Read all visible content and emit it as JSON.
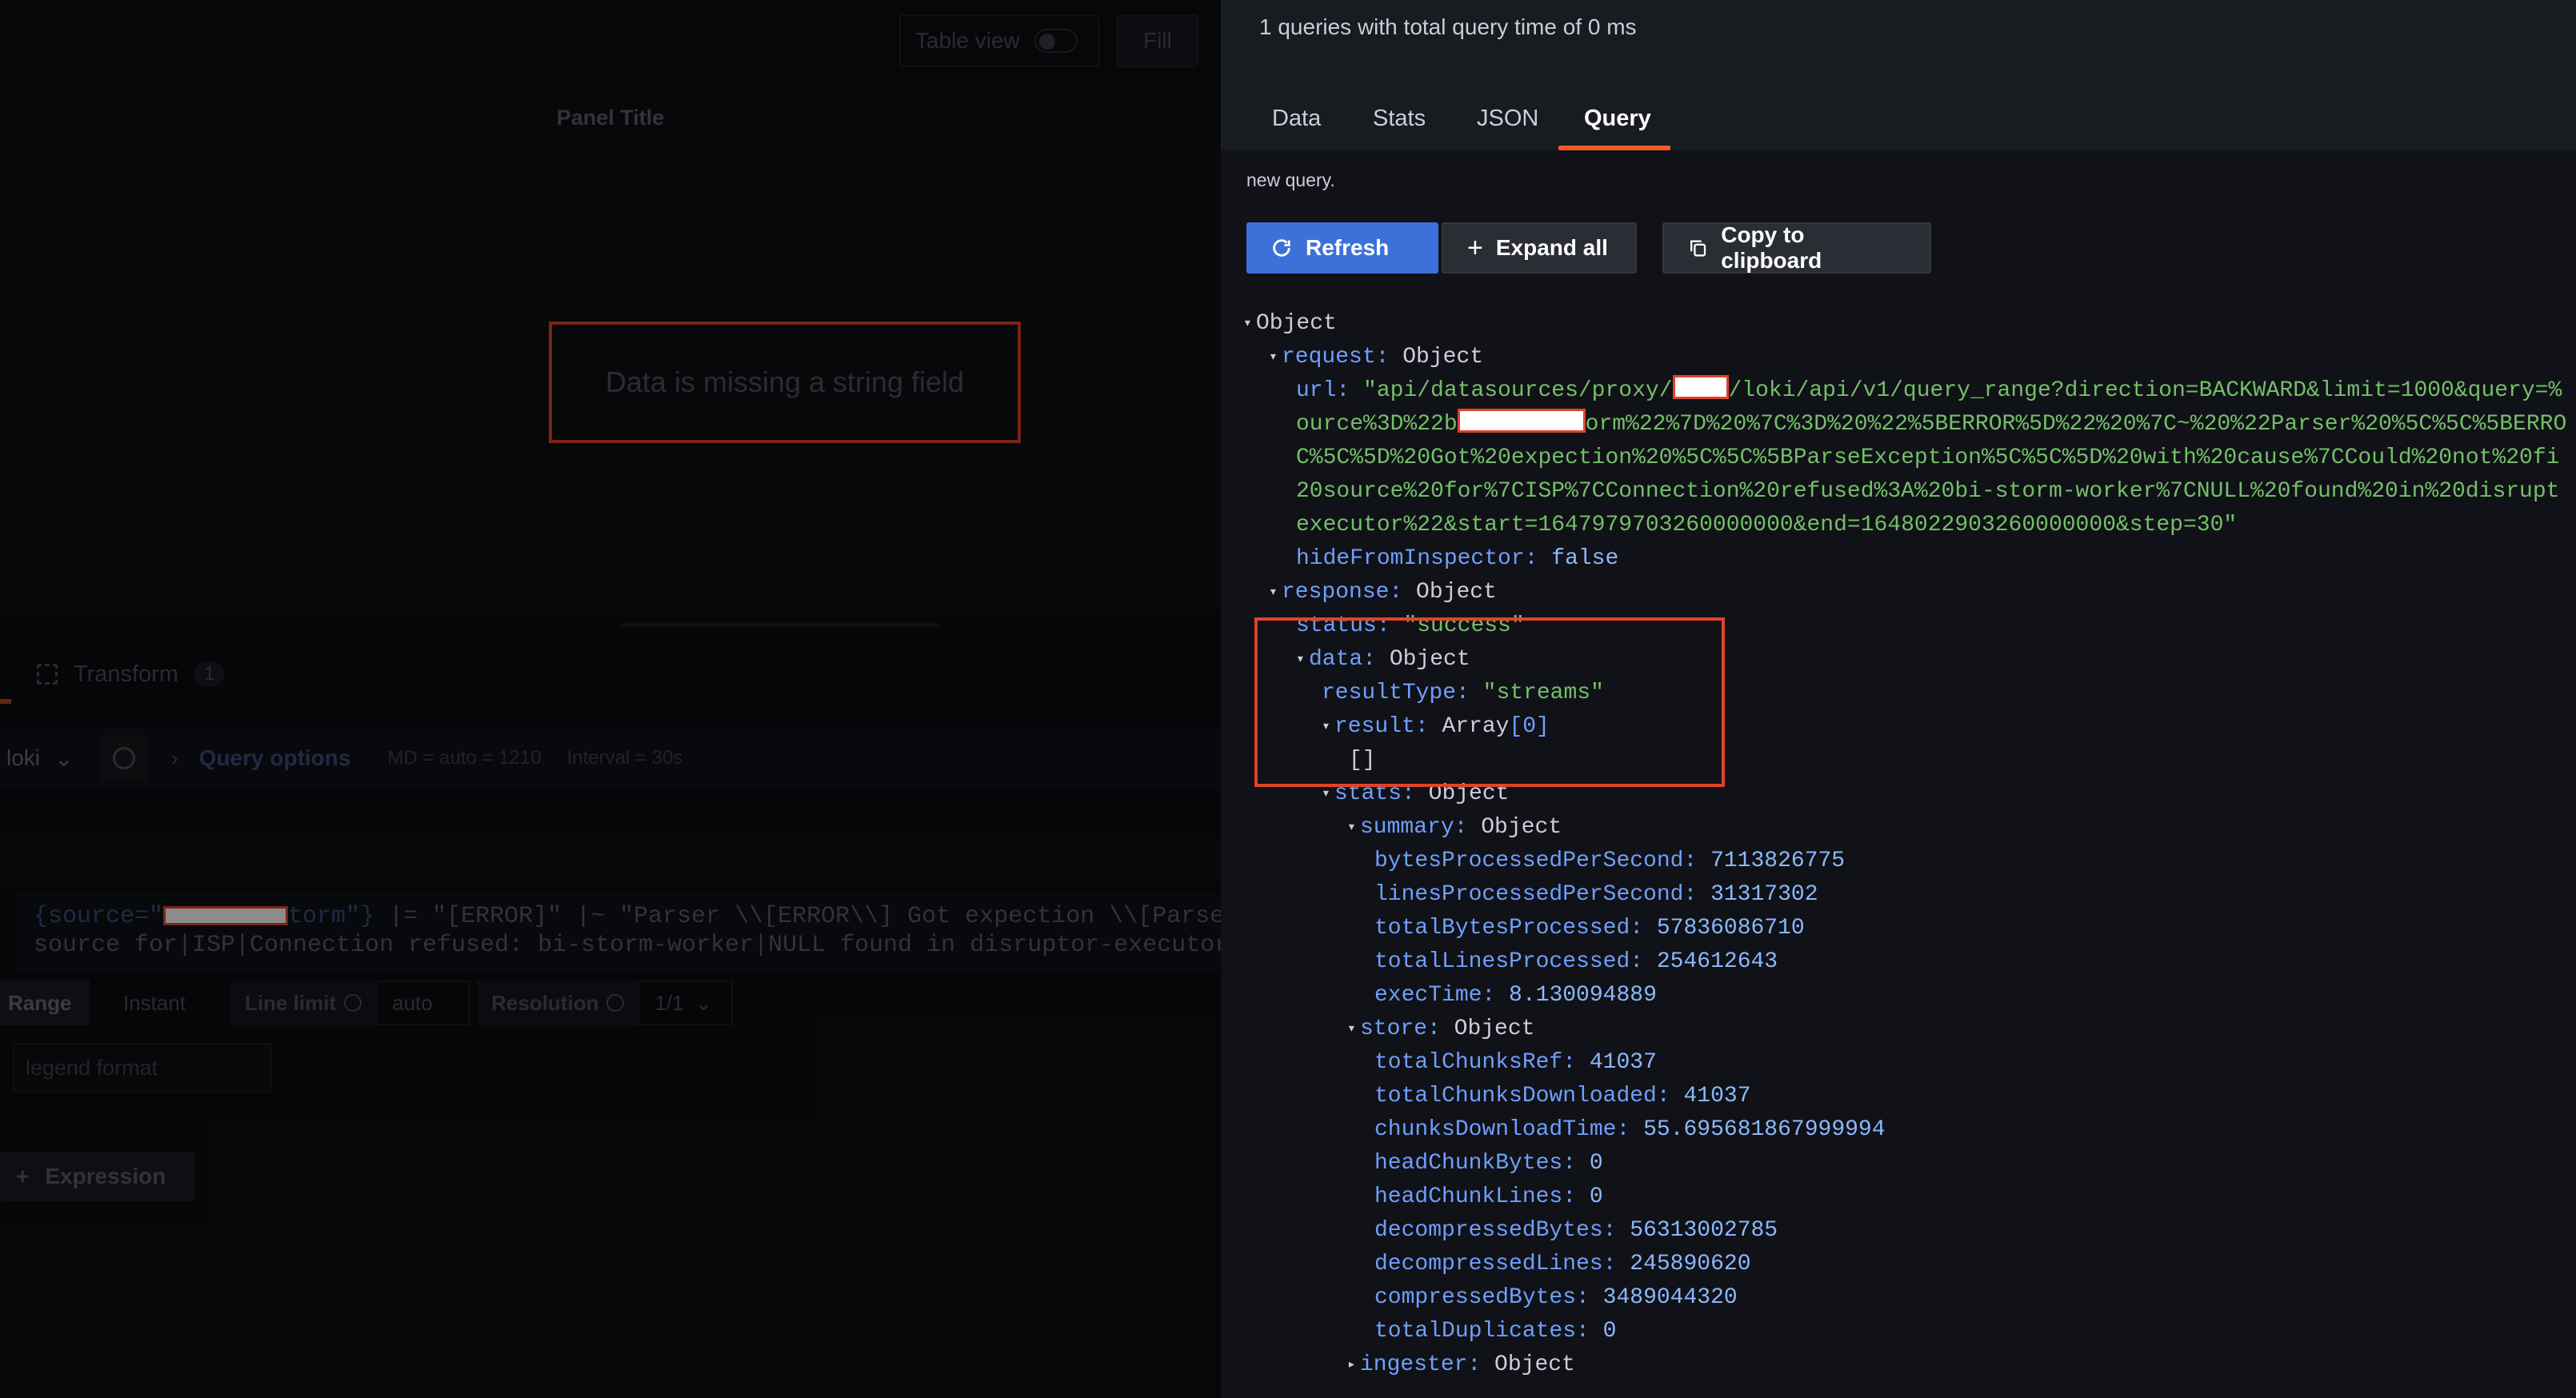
{
  "left": {
    "table_view_label": "Table view",
    "fill_label": "Fill",
    "panel_title": "Panel Title",
    "error_message": "Data is missing a string field",
    "transform_label": "Transform",
    "transform_count": "1",
    "datasource": "loki",
    "query_options_label": "Query options",
    "md_meta": "MD = auto = 1210",
    "interval_meta": "Interval = 30s",
    "query_line1_a": "{source=\"",
    "query_line1_b": "torm\"}",
    "query_line1_c": " |= \"[ERROR]\" |~ \"Parser \\\\[ERROR\\\\] Got expection \\\\[ParseExce",
    "query_line2": "source for|ISP|Connection refused: bi-storm-worker|NULL found in disruptor-executor\"",
    "range_label": "Range",
    "instant_label": "Instant",
    "line_limit_label": "Line limit",
    "line_limit_value": "auto",
    "resolution_label": "Resolution",
    "resolution_value": "1/1",
    "legend_placeholder": "legend format",
    "expression_label": "Expression"
  },
  "inspector": {
    "summary": "1 queries with total query time of 0 ms",
    "tabs": [
      "Data",
      "Stats",
      "JSON",
      "Query"
    ],
    "active_tab": "Query",
    "subtitle": "new query.",
    "refresh_label": "Refresh",
    "expand_label": "Expand all",
    "copy_label": "Copy to clipboard",
    "json": {
      "root": "Object",
      "request_key": "request:",
      "request_val": "Object",
      "url_key": "url:",
      "url_line1_a": "\"api/datasources/proxy/",
      "url_line1_b": "/loki/api/v1/query_range?direction=BACKWARD&limit=1000&query=%",
      "url_line2_a": "ource%3D%22b",
      "url_line2_b": "orm%22%7D%20%7C%3D%20%22%5BERROR%5D%22%20%7C~%20%22Parser%20%5C%5C%5BERRO",
      "url_line3": "C%5C%5D%20Got%20expection%20%5C%5C%5BParseException%5C%5C%5D%20with%20cause%7CCould%20not%20fi",
      "url_line4": "20source%20for%7CISP%7CConnection%20refused%3A%20bi-storm-worker%7CNULL%20found%20in%20disrupt",
      "url_line5": "executor%22&start=1647979703260000000&end=1648022903260000000&step=30\"",
      "hide_key": "hideFromInspector:",
      "hide_val": "false",
      "response_key": "response:",
      "response_val": "Object",
      "status_key": "status:",
      "status_val": "\"success\"",
      "data_key": "data:",
      "data_val": "Object",
      "resultType_key": "resultType:",
      "resultType_val": "\"streams\"",
      "result_key": "result:",
      "result_val": "Array",
      "result_len": "[0]",
      "empty_array": "[]",
      "stats_key": "stats:",
      "stats_val": "Object",
      "summary_key": "summary:",
      "summary_val": "Object",
      "bps_key": "bytesProcessedPerSecond:",
      "bps_val": "7113826775",
      "lps_key": "linesProcessedPerSecond:",
      "lps_val": "31317302",
      "tbp_key": "totalBytesProcessed:",
      "tbp_val": "57836086710",
      "tlp_key": "totalLinesProcessed:",
      "tlp_val": "254612643",
      "exec_key": "execTime:",
      "exec_val": "8.130094889",
      "store_key": "store:",
      "store_val": "Object",
      "tcr_key": "totalChunksRef:",
      "tcr_val": "41037",
      "tcd_key": "totalChunksDownloaded:",
      "tcd_val": "41037",
      "cdt_key": "chunksDownloadTime:",
      "cdt_val": "55.695681867999994",
      "hcb_key": "headChunkBytes:",
      "hcb_val": "0",
      "hcl_key": "headChunkLines:",
      "hcl_val": "0",
      "db_key": "decompressedBytes:",
      "db_val": "56313002785",
      "dl_key": "decompressedLines:",
      "dl_val": "245890620",
      "cb_key": "compressedBytes:",
      "cb_val": "3489044320",
      "td_key": "totalDuplicates:",
      "td_val": "0",
      "ingester_key": "ingester:",
      "ingester_val": "Object"
    }
  },
  "colors": {
    "accent_orange": "#f05a28",
    "primary_blue": "#3d71d9",
    "annotation_red": "#e0432a",
    "json_key": "#6e9fff",
    "json_string": "#73bf69",
    "json_number": "#8ab8ff"
  },
  "icons": [
    "refresh-icon",
    "plus-icon",
    "copy-icon",
    "transform-icon",
    "history-icon",
    "chevron-right-icon",
    "chevron-down-icon",
    "info-icon",
    "expand-triangle-icon",
    "collapse-triangle-icon"
  ]
}
